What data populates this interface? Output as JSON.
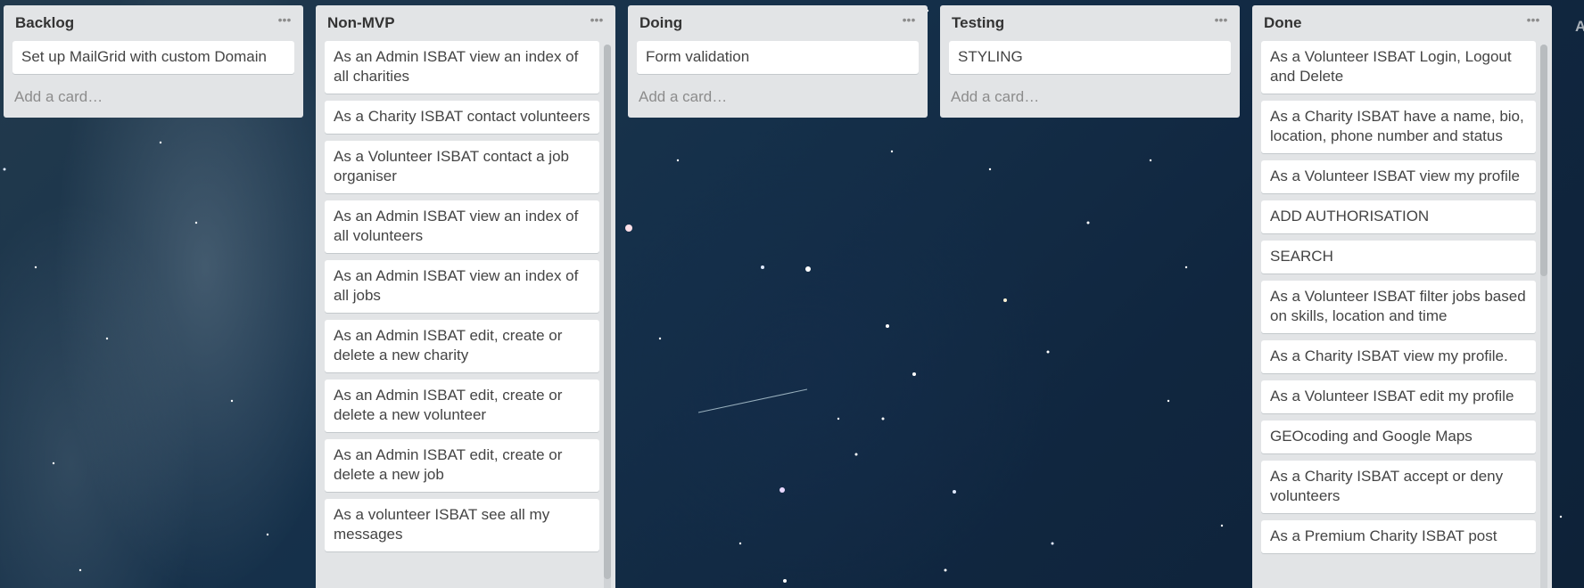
{
  "board": {
    "lists": [
      {
        "title": "Backlog",
        "cards": [
          "Set up MailGrid with custom Domain"
        ],
        "add_card": "Add a card…"
      },
      {
        "title": "Non-MVP",
        "cards": [
          "As an Admin ISBAT view an index of all charities",
          "As a Charity ISBAT contact volunteers",
          "As a Volunteer ISBAT contact a job organiser",
          "As an Admin ISBAT view an index of all volunteers",
          "As an Admin ISBAT view an index of all jobs",
          "As an Admin ISBAT edit, create or delete a new charity",
          "As an Admin ISBAT edit, create or delete a new volunteer",
          "As an Admin ISBAT edit, create or delete a new job",
          "As a volunteer ISBAT see all my messages"
        ]
      },
      {
        "title": "Doing",
        "cards": [
          "Form validation"
        ],
        "add_card": "Add a card…"
      },
      {
        "title": "Testing",
        "cards": [
          "STYLING"
        ],
        "add_card": "Add a card…"
      },
      {
        "title": "Done",
        "cards": [
          "As a Volunteer ISBAT Login, Logout and Delete",
          "As a Charity ISBAT have a name, bio, location, phone number and status",
          "As a Volunteer ISBAT view my profile",
          "ADD AUTHORISATION",
          "SEARCH",
          "As a Volunteer ISBAT filter jobs based on skills, location and time",
          "As a Charity ISBAT view my profile.",
          "As a Volunteer ISBAT edit my profile",
          "GEOcoding and Google Maps",
          "As a Charity ISBAT accept or deny volunteers",
          "As a Premium Charity ISBAT post"
        ]
      }
    ],
    "next_list_partial": "A"
  },
  "icons": {
    "list_menu": "ellipsis-icon"
  },
  "colors": {
    "list_bg": "#e2e4e6",
    "card_bg": "#ffffff",
    "card_text": "#444444",
    "title_text": "#333333",
    "muted_text": "#8c8c8c"
  }
}
